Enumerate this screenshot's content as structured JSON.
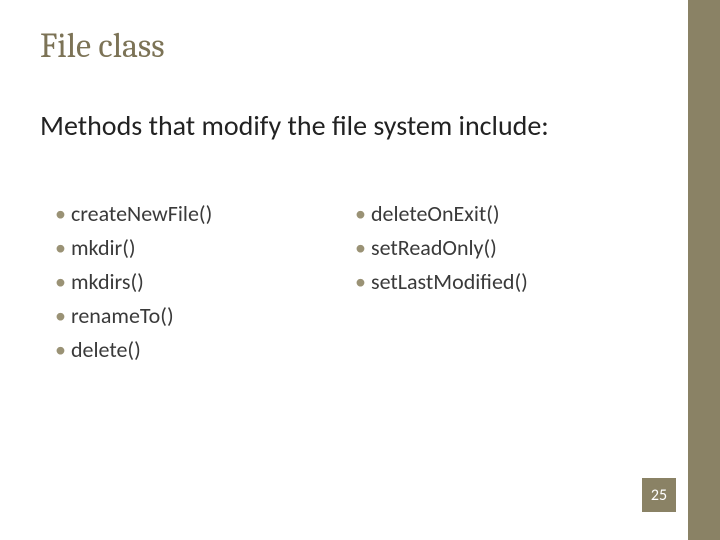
{
  "title": "File class",
  "subtitle": "Methods that modify the file system include:",
  "columns": {
    "left": [
      "createNewFile()",
      "mkdir()",
      "mkdirs()",
      "renameTo()",
      "delete()"
    ],
    "right": [
      "deleteOnExit()",
      "setReadOnly()",
      "setLastModified()"
    ]
  },
  "page_number": "25",
  "colors": {
    "accent": "#8a8265",
    "title": "#7c7356",
    "text": "#3a3a3a"
  }
}
